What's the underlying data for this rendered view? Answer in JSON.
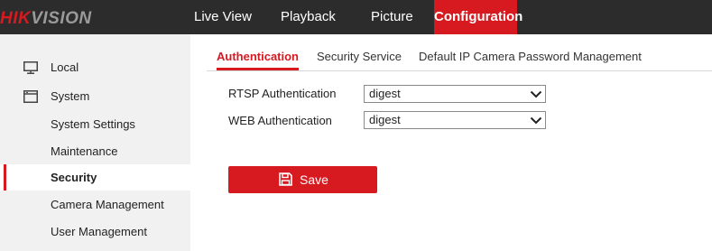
{
  "brand": {
    "logo_part1": "HIK",
    "logo_part2": "VISION"
  },
  "topnav": {
    "items": [
      {
        "label": "Live View"
      },
      {
        "label": "Playback"
      },
      {
        "label": "Picture"
      },
      {
        "label": "Configuration",
        "active": true
      }
    ]
  },
  "sidebar": {
    "items": [
      {
        "label": "Local",
        "icon": "monitor-icon"
      },
      {
        "label": "System",
        "icon": "system-window-icon"
      },
      {
        "label": "System Settings"
      },
      {
        "label": "Maintenance"
      },
      {
        "label": "Security",
        "active": true
      },
      {
        "label": "Camera Management"
      },
      {
        "label": "User Management"
      }
    ]
  },
  "tabs": {
    "items": [
      {
        "label": "Authentication",
        "active": true
      },
      {
        "label": "Security Service"
      },
      {
        "label": "Default IP Camera Password Management"
      }
    ]
  },
  "form": {
    "rtsp": {
      "label": "RTSP Authentication",
      "value": "digest"
    },
    "web": {
      "label": "WEB Authentication",
      "value": "digest"
    }
  },
  "actions": {
    "save_label": "Save",
    "save_icon": "floppy-disk-icon"
  },
  "colors": {
    "accent": "#d71920",
    "topbar": "#2c2c2c",
    "sidebar": "#f1f1f1"
  }
}
